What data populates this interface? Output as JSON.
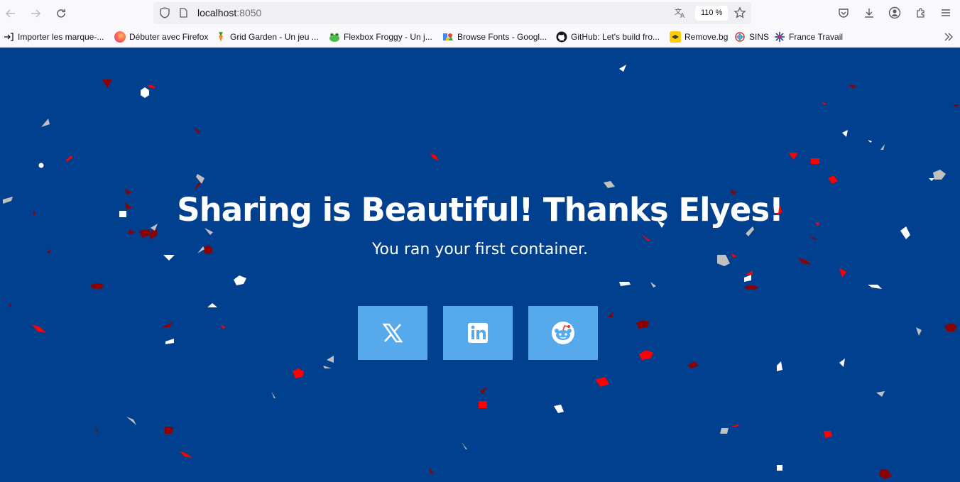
{
  "browser": {
    "url_host": "localhost",
    "url_port": ":8050",
    "zoom": "110 %"
  },
  "bookmarks": [
    {
      "label": "Importer les marque-...",
      "icon": "import-icon"
    },
    {
      "label": "Débuter avec Firefox",
      "icon": "firefox-icon"
    },
    {
      "label": "Grid Garden - Un jeu ...",
      "icon": "carrot-icon"
    },
    {
      "label": "Flexbox Froggy - Un j...",
      "icon": "frog-icon"
    },
    {
      "label": "Browse Fonts - Googl...",
      "icon": "google-fonts-icon"
    },
    {
      "label": "GitHub: Let's build fro...",
      "icon": "github-icon"
    },
    {
      "label": "Remove.bg",
      "icon": "removebg-icon"
    },
    {
      "label": "SINS",
      "icon": "sins-icon"
    },
    {
      "label": "France Travail",
      "icon": "france-travail-icon"
    }
  ],
  "page": {
    "heading": "Sharing is Beautiful! Thanks Elyes!",
    "subtitle": "You ran your first container.",
    "share_buttons": [
      {
        "name": "x-twitter",
        "icon": "x-icon"
      },
      {
        "name": "linkedin",
        "icon": "linkedin-icon"
      },
      {
        "name": "reddit",
        "icon": "reddit-icon"
      }
    ]
  },
  "colors": {
    "page_background": "#00408e",
    "share_button": "#56a9ea",
    "confetti": [
      "#ff0000",
      "#8b0000",
      "#ffffff",
      "#c0c0c0"
    ]
  }
}
